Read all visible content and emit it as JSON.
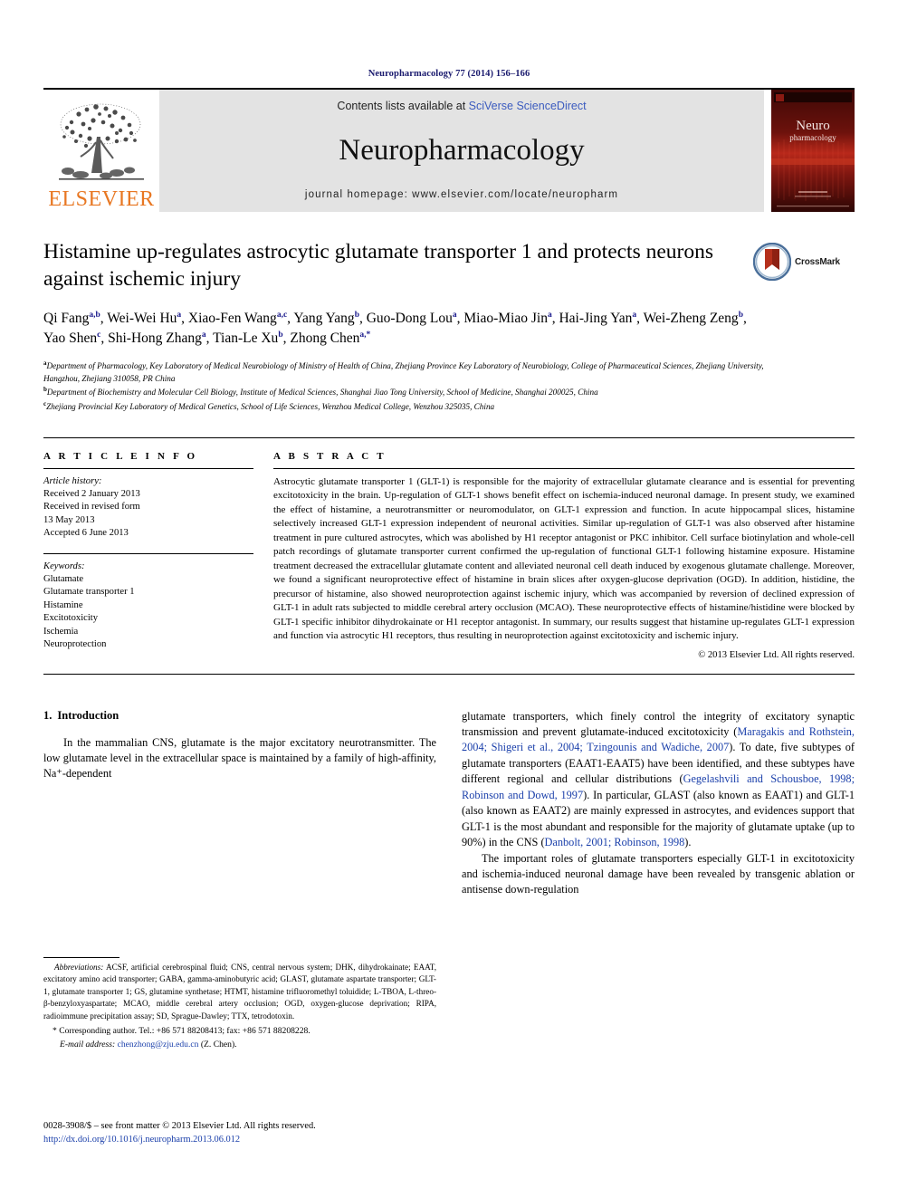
{
  "running_head": "Neuropharmacology 77 (2014) 156–166",
  "masthead": {
    "publisher_logo_text": "ELSEVIER",
    "contents_prefix": "Contents lists available at ",
    "contents_link": "SciVerse ScienceDirect",
    "journal_title": "Neuropharmacology",
    "homepage_line": "journal homepage: www.elsevier.com/locate/neuropharm",
    "cover_line1": "Neuro",
    "cover_line2": "pharmacology"
  },
  "title": "Histamine up-regulates astrocytic glutamate transporter 1 and protects neurons against ischemic injury",
  "crossmark_label": "CrossMark",
  "authors_html": "Qi Fang<sup>a,b</sup>, Wei-Wei Hu<sup>a</sup>, Xiao-Fen Wang<sup>a,c</sup>, Yang Yang<sup>b</sup>, Guo-Dong Lou<sup>a</sup>, Miao-Miao Jin<sup>a</sup>, Hai-Jing Yan<sup>a</sup>, Wei-Zheng Zeng<sup>b</sup>, Yao Shen<sup>c</sup>, Shi-Hong Zhang<sup>a</sup>, Tian-Le Xu<sup>b</sup>, Zhong Chen<sup>a,*</sup>",
  "affiliations": [
    "Department of Pharmacology, Key Laboratory of Medical Neurobiology of Ministry of Health of China, Zhejiang Province Key Laboratory of Neurobiology, College of Pharmaceutical Sciences, Zhejiang University, Hangzhou, Zhejiang 310058, PR China",
    "Department of Biochemistry and Molecular Cell Biology, Institute of Medical Sciences, Shanghai Jiao Tong University, School of Medicine, Shanghai 200025, China",
    "Zhejiang Provincial Key Laboratory of Medical Genetics, School of Life Sciences, Wenzhou Medical College, Wenzhou 325035, China"
  ],
  "affiliation_markers": [
    "a",
    "b",
    "c"
  ],
  "article_info": {
    "heading": "A R T I C L E   I N F O",
    "history_label": "Article history:",
    "history": [
      "Received 2 January 2013",
      "Received in revised form",
      "13 May 2013",
      "Accepted 6 June 2013"
    ],
    "keywords_label": "Keywords:",
    "keywords": [
      "Glutamate",
      "Glutamate transporter 1",
      "Histamine",
      "Excitotoxicity",
      "Ischemia",
      "Neuroprotection"
    ]
  },
  "abstract": {
    "heading": "A B S T R A C T",
    "text": "Astrocytic glutamate transporter 1 (GLT-1) is responsible for the majority of extracellular glutamate clearance and is essential for preventing excitotoxicity in the brain. Up-regulation of GLT-1 shows benefit effect on ischemia-induced neuronal damage. In present study, we examined the effect of histamine, a neurotransmitter or neuromodulator, on GLT-1 expression and function. In acute hippocampal slices, histamine selectively increased GLT-1 expression independent of neuronal activities. Similar up-regulation of GLT-1 was also observed after histamine treatment in pure cultured astrocytes, which was abolished by H1 receptor antagonist or PKC inhibitor. Cell surface biotinylation and whole-cell patch recordings of glutamate transporter current confirmed the up-regulation of functional GLT-1 following histamine exposure. Histamine treatment decreased the extracellular glutamate content and alleviated neuronal cell death induced by exogenous glutamate challenge. Moreover, we found a significant neuroprotective effect of histamine in brain slices after oxygen-glucose deprivation (OGD). In addition, histidine, the precursor of histamine, also showed neuroprotection against ischemic injury, which was accompanied by reversion of declined expression of GLT-1 in adult rats subjected to middle cerebral artery occlusion (MCAO). These neuroprotective effects of histamine/histidine were blocked by GLT-1 specific inhibitor dihydrokainate or H1 receptor antagonist. In summary, our results suggest that histamine up-regulates GLT-1 expression and function via astrocytic H1 receptors, thus resulting in neuroprotection against excitotoxicity and ischemic injury.",
    "copyright": "© 2013 Elsevier Ltd. All rights reserved."
  },
  "introduction": {
    "number": "1.",
    "heading": "Introduction",
    "left_para": "In the mammalian CNS, glutamate is the major excitatory neurotransmitter. The low glutamate level in the extracellular space is maintained by a family of high-affinity, Na⁺-dependent"
  },
  "right_column": {
    "para1_part1": "glutamate transporters, which finely control the integrity of excitatory synaptic transmission and prevent glutamate-induced excitotoxicity (",
    "para1_cite1": "Maragakis and Rothstein, 2004; Shigeri et al., 2004; Tzingounis and Wadiche, 2007",
    "para1_part2": "). To date, five subtypes of glutamate transporters (EAAT1-EAAT5) have been identified, and these subtypes have different regional and cellular distributions (",
    "para1_cite2": "Gegelashvili and Schousboe, 1998; Robinson and Dowd, 1997",
    "para1_part3": "). In particular, GLAST (also known as EAAT1) and GLT-1 (also known as EAAT2) are mainly expressed in astrocytes, and evidences support that GLT-1 is the most abundant and responsible for the majority of glutamate uptake (up to 90%) in the CNS (",
    "para1_cite3": "Danbolt, 2001; Robinson, 1998",
    "para1_part4": ").",
    "para2": "The important roles of glutamate transporters especially GLT-1 in excitotoxicity and ischemia-induced neuronal damage have been revealed by transgenic ablation or antisense down-regulation"
  },
  "footnotes": {
    "abbrev_label": "Abbreviations:",
    "abbrev_text": " ACSF, artificial cerebrospinal fluid; CNS, central nervous system; DHK, dihydrokainate; EAAT, excitatory amino acid transporter; GABA, gamma-aminobutyric acid; GLAST, glutamate aspartate transporter; GLT-1, glutamate transporter 1; GS, glutamine synthetase; HTMT, histamine trifluoromethyl toluidide; L-TBOA, L-threo-β-benzyloxyaspartate; MCAO, middle cerebral artery occlusion; OGD, oxygen-glucose deprivation; RIPA, radioimmune precipitation assay; SD, Sprague-Dawley; TTX, tetrodotoxin.",
    "corresponding": "* Corresponding author. Tel.: +86 571 88208413; fax: +86 571 88208228.",
    "email_label": "E-mail address:",
    "email": "chenzhong@zju.edu.cn",
    "email_suffix": " (Z. Chen)."
  },
  "footer": {
    "issn_line": "0028-3908/$ – see front matter © 2013 Elsevier Ltd. All rights reserved.",
    "doi": "http://dx.doi.org/10.1016/j.neuropharm.2013.06.012"
  },
  "colors": {
    "link": "#1a3faa",
    "elsevier_orange": "#E87722",
    "band_gray": "#e3e3e3",
    "runhead_navy": "#1a1a6e",
    "sup_navy": "#1a1a8c"
  }
}
